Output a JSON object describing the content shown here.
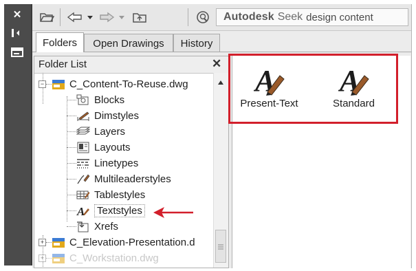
{
  "left_strip": {
    "close_glyph": "✕",
    "pin_glyph": "▮◀▶",
    "props_glyph": "☰"
  },
  "toolbar": {
    "brand_name": "Autodesk",
    "brand_seek": "Seek",
    "brand_rest": "design content"
  },
  "tabs": [
    {
      "label": "Folders",
      "active": true
    },
    {
      "label": "Open Drawings",
      "active": false
    },
    {
      "label": "History",
      "active": false
    }
  ],
  "folder_pane": {
    "title": "Folder List",
    "close_glyph": "✕",
    "root_files": [
      {
        "label": "C_Content-To-Reuse.dwg",
        "expanded": true
      },
      {
        "label": "C_Elevation-Presentation.d",
        "expanded": false
      },
      {
        "label": "C_Workstation.dwg",
        "expanded": false
      }
    ],
    "children": [
      {
        "label": "Blocks",
        "icon": "blocks-icon"
      },
      {
        "label": "Dimstyles",
        "icon": "dimstyles-icon"
      },
      {
        "label": "Layers",
        "icon": "layers-icon"
      },
      {
        "label": "Layouts",
        "icon": "layouts-icon"
      },
      {
        "label": "Linetypes",
        "icon": "linetypes-icon"
      },
      {
        "label": "Multileaderstyles",
        "icon": "multileaderstyles-icon"
      },
      {
        "label": "Tablestyles",
        "icon": "tablestyles-icon"
      },
      {
        "label": "Textstyles",
        "icon": "textstyles-icon",
        "selected": true
      },
      {
        "label": "Xrefs",
        "icon": "xrefs-icon"
      }
    ]
  },
  "content_items": [
    {
      "label": "Present-Text",
      "icon": "textstyle-icon"
    },
    {
      "label": "Standard",
      "icon": "textstyle-icon"
    }
  ],
  "colors": {
    "highlight": "#d21f2b",
    "palette_strip": "#4b4b4b",
    "folder_icon": "#e3a91a"
  }
}
